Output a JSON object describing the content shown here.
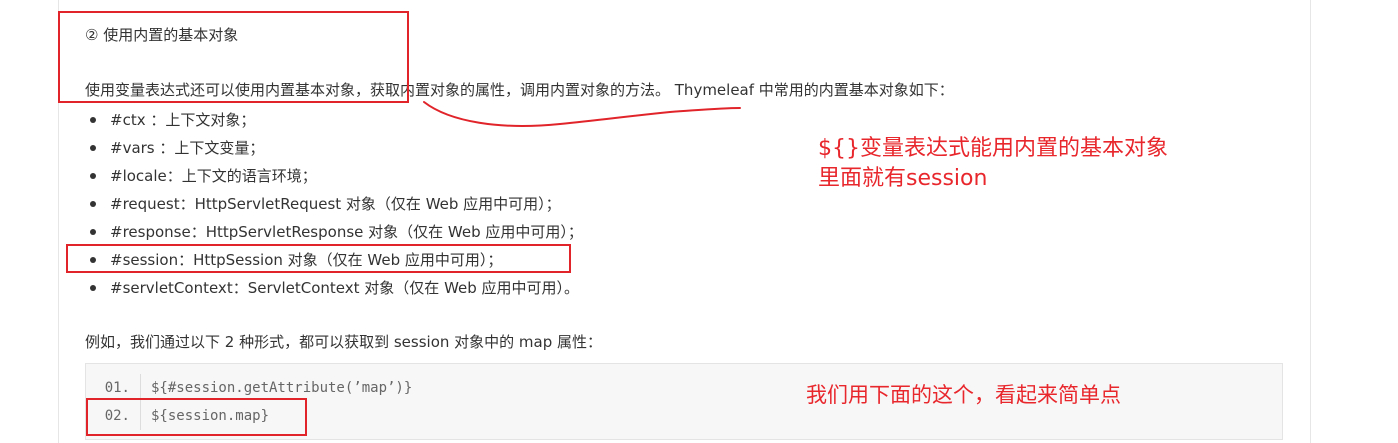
{
  "section": {
    "heading": "② 使用内置的基本对象",
    "intro": "使用变量表达式还可以使用内置基本对象，获取内置对象的属性，调用内置对象的方法。 Thymeleaf 中常用的内置基本对象如下：",
    "objects": [
      "#ctx ：上下文对象；",
      "#vars ：上下文变量；",
      "#locale：上下文的语言环境；",
      "#request：HttpServletRequest 对象（仅在 Web 应用中可用）；",
      "#response：HttpServletResponse 对象（仅在 Web 应用中可用）；",
      "#session：HttpSession 对象（仅在 Web 应用中可用）；",
      "#servletContext：ServletContext 对象（仅在 Web 应用中可用）。"
    ],
    "example": "例如，我们通过以下 2 种形式，都可以获取到 session 对象中的 map 属性："
  },
  "code": {
    "lines": [
      {
        "num": "01.",
        "text": "${#session.getAttribute(’map’)}"
      },
      {
        "num": "02.",
        "text": "${session.map}"
      }
    ]
  },
  "annotations": {
    "note1_line1": "${}变量表达式能用内置的基本对象",
    "note1_line2": "里面就有session",
    "note2": "我们用下面的这个，看起来简单点",
    "color": "#e8272d"
  }
}
